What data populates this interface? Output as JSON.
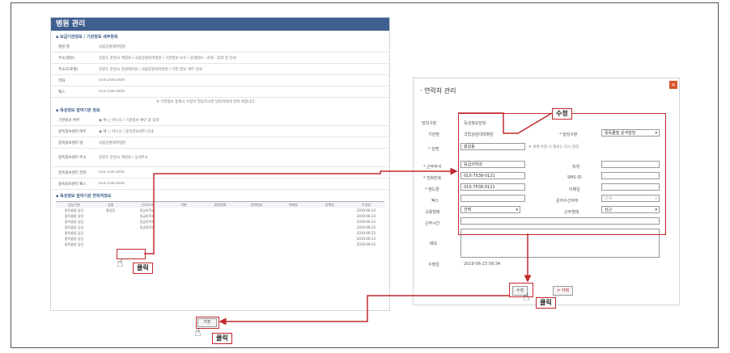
{
  "left_panel": {
    "title": "병원 관리",
    "section1": "▪ 보급기관정보 / 기관정보 세부항목",
    "rows1": [
      {
        "k": "병원 명",
        "v": "국립강원대학병원"
      },
      {
        "k": "주소(병원)",
        "v": "강원도 춘천시 백령로 / 국립강원대학병원 / 기관정보 보호 / 상세정보 · 조회 · 입력 및 안내"
      },
      {
        "k": "주소(도로명)",
        "v": "강원도 춘천시 강원대학길 / 국립강원대학병원 / 기관 정보 세부 안내"
      },
      {
        "k": "전화",
        "v": "033-258-2000"
      },
      {
        "k": "팩스",
        "v": "033-258-2000"
      }
    ],
    "note1": "※ 기관정보 등록시 수정이 필요하시면 담당자에게 연락 바랍니다.",
    "section2": "▪ 독성정보 참여기관 정보",
    "rows2": [
      {
        "k": "기관정보 여부",
        "v": "◉ 예  ○ 아니오 / 기관정보 확인 후 입력"
      },
      {
        "k": "중독정보센터 여부",
        "v": "◉ 예  ○ 아니오 / 중독정보센터 안내"
      },
      {
        "k": "중독정보센터 명",
        "v": "국립강원대학병원"
      },
      {
        "k": "중독정보센터 주소",
        "v": "강원도 춘천시 백령로 / 상세주소"
      },
      {
        "k": "중독정보센터 전화",
        "v": "033-258-2000"
      },
      {
        "k": "중독정보센터 팩스",
        "v": "033-258-2000"
      }
    ],
    "section3": "▪ 독성정보 참여기관 연락처정보",
    "table_headers": [
      "담당구분",
      "성명",
      "근무부서",
      "직위",
      "휴대전화",
      "전화번호",
      "이메일",
      "등록일",
      "수정일"
    ],
    "table_rows": [
      [
        "중독물질 담당",
        "홍길동",
        "응급의학과",
        "",
        "",
        "",
        "",
        "",
        "2019-06-23"
      ],
      [
        "중독물질 담당",
        "",
        "응급의학과",
        "",
        "",
        "",
        "",
        "",
        "2019-06-23"
      ],
      [
        "중독물질 담당",
        "",
        "응급의학과",
        "",
        "",
        "",
        "",
        "",
        "2019-06-23"
      ],
      [
        "중독물질 담당",
        "",
        "응급의학과",
        "",
        "",
        "",
        "",
        "",
        "2019-06-23"
      ],
      [
        "중독물질 담당",
        "",
        "",
        "",
        "",
        "",
        "",
        "",
        "2019-06-23"
      ],
      [
        "중독물질 담당",
        "",
        "",
        "",
        "",
        "",
        "",
        "",
        "2019-06-23"
      ],
      [
        "중독물질 담당",
        "",
        "",
        "",
        "",
        "",
        "",
        "",
        "2019-06-23"
      ]
    ],
    "save_label": "저장",
    "click1": "클릭",
    "click3": "클릭"
  },
  "right_panel": {
    "title": "· 연락처 관리",
    "close": "×",
    "badge_label": "수정",
    "fields": {
      "category_label": "담당구분",
      "category_value": "독성정보담당",
      "org_label": "기관명",
      "org_value": "국립강원대학병원",
      "role_label": "* 담당구분",
      "role_value": "중독물질 윤석담당",
      "name_label": "* 성명",
      "name_value": "홍길동",
      "name_note": "※ 성명 수정 시 정보는 다시 입력",
      "dept_label": "* 근무부서",
      "dept_value": "응급의학과",
      "position_label": "직위",
      "phone_label": "* 전화번호",
      "phone_value": "010-7538-0121",
      "sms_label": "SMS ID",
      "mobile_label": "* 핸드폰",
      "mobile_value": "010-7538-0121",
      "email_label": "이메일",
      "fax_label": "팩스",
      "reply_label": "문자수신여부",
      "reply_value": "선택",
      "employ_label": "고용형태",
      "employ_value": "선택",
      "work_label": "근무형태",
      "work_value": "상근",
      "time_label": "근무시간",
      "memo_label": "메모",
      "date_label": "수정일",
      "date_value": "2019-06-23 09:34"
    },
    "modify_button": "수정",
    "delete_button": "삭제",
    "click2": "클릭"
  }
}
